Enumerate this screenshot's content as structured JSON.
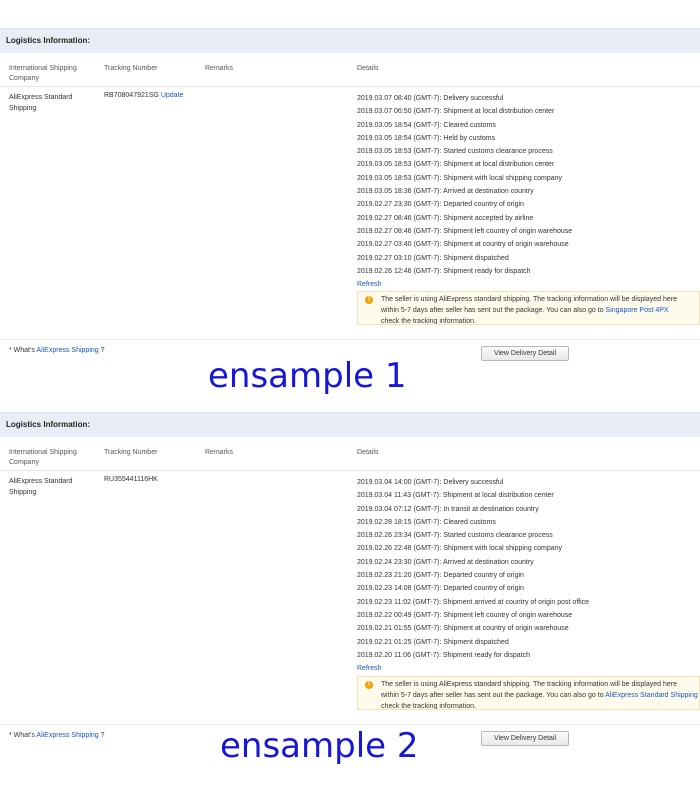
{
  "header": {
    "title": "Logistics Information:",
    "col_company": "International Shipping Company",
    "col_tracking": "Tracking Number",
    "col_remarks": "Remarks",
    "col_details": "Details"
  },
  "samples": [
    {
      "company": "AliExpress Standard Shipping",
      "tracking_number": "RB708047921SG",
      "update_link": "Update",
      "events": [
        "2019.03.07 08:40 (GMT-7): Delivery successful",
        "2019.03.07 06:50 (GMT-7): Shipment at local distribution center",
        "2019.03.05 18:54 (GMT-7): Cleared customs",
        "2019.03.05 18:54 (GMT-7): Held by customs",
        "2019.03.05 18:53 (GMT-7): Started customs clearance process",
        "2019.03.05 18:53 (GMT-7): Shipment at local distribution center",
        "2019.03.05 18:53 (GMT-7): Shipment with local shipping company",
        "2019.03.05 18:36 (GMT-7): Arrived at destination country",
        "2019.02.27 23:30 (GMT-7): Departed country of origin",
        "2019.02.27 08:46 (GMT-7): Shipment accepted by airline",
        "2019.02.27 08:46 (GMT-7): Shipment left country of origin warehouse",
        "2019.02.27 03:40 (GMT-7): Shipment at country of origin warehouse",
        "2019.02.27 03:10 (GMT-7): Shipment dispatched",
        "2019.02.26 12:46 (GMT-7): Shipment ready for dispatch"
      ],
      "refresh": "Refresh",
      "notice_line1": "The seller is using AliExpress standard shipping. The tracking information will be displayed here",
      "notice_line2_prefix": "within 5-7 days after seller has sent out the package. You can also go to ",
      "notice_link": "Singapore Post 4PX",
      "notice_line3": "check the tracking information.",
      "whats_prefix": "* What's ",
      "whats_link": "AliExpress Shipping",
      "whats_suffix": " ?",
      "button": "View Delivery Detail",
      "caption": "ensample 1"
    },
    {
      "company": "AliExpress Standard Shipping",
      "tracking_number": "RU355441116HK",
      "update_link": "",
      "events": [
        "2019.03.04 14:00 (GMT-7): Delivery successful",
        "2019.03.04 11:43 (GMT-7): Shipment at local distribution center",
        "2019.03.04 07:12 (GMT-7): In transit at destination country",
        "2019.02.28 18:15 (GMT-7): Cleared customs",
        "2019.02.26 23:34 (GMT-7): Started customs clearance process",
        "2019.02.26 22:48 (GMT-7): Shipment with local shipping company",
        "2019.02.24 23:30 (GMT-7): Arrived at destination country",
        "2019.02.23 21:20 (GMT-7): Departed country of origin",
        "2019.02.23 14:08 (GMT-7): Departed country of origin",
        "2019.02.23 11:02 (GMT-7): Shipment arrived at country of origin post office",
        "2019.02.22 00:49 (GMT-7): Shipment left country of origin warehouse",
        "2019.02.21 01:55 (GMT-7): Shipment at country of origin warehouse",
        "2019.02.21 01:25 (GMT-7): Shipment dispatched",
        "2019.02.20 11:06 (GMT-7): Shipment ready for dispatch"
      ],
      "refresh": "Refresh",
      "notice_line1": "The seller is using AliExpress standard shipping. The tracking information will be displayed here",
      "notice_line2_prefix": "within 5-7 days after seller has sent out the package. You can also go to ",
      "notice_link": "AliExpress Standard Shipping",
      "notice_line3": " check the tracking information.",
      "whats_prefix": "* What's ",
      "whats_link": "AliExpress Shipping",
      "whats_suffix": " ?",
      "button": "View Delivery Detail",
      "caption": "ensample 2"
    }
  ],
  "icons": {
    "notice": "info-pin-icon"
  },
  "colors": {
    "link": "#1757c2",
    "caption": "#1717d6",
    "notice_bg": "#fffbec",
    "header_bar": "#e9eef6"
  }
}
